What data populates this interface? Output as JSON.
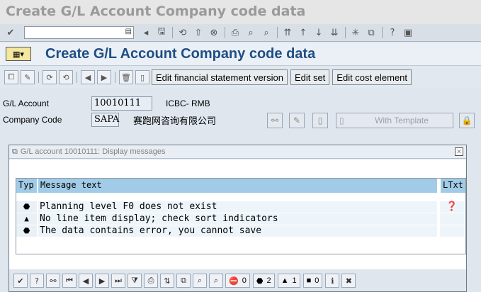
{
  "window": {
    "title": "Create G/L Account Company code data"
  },
  "std_toolbar": {
    "command_value": ""
  },
  "page": {
    "title": "Create G/L Account Company code data"
  },
  "app_toolbar": {
    "buttons": [
      "Edit financial statement version",
      "Edit set",
      "Edit cost element"
    ]
  },
  "form": {
    "gl_account_label": "G/L Account",
    "gl_account_value": "10010111",
    "gl_account_desc": "ICBC- RMB",
    "company_code_label": "Company Code",
    "company_code_value": "SAPA",
    "company_code_desc": "赛跑网咨询有限公司",
    "with_template_label": "With Template"
  },
  "dialog": {
    "title": "G/L account 10010111: Display messages",
    "columns": {
      "typ": "Typ",
      "text": "Message text",
      "ltxt": "LTxt"
    },
    "messages": [
      {
        "type": "error",
        "text": "Planning level F0 does not exist",
        "has_long_text": true
      },
      {
        "type": "warning",
        "text": "No line item display; check sort indicators",
        "has_long_text": false
      },
      {
        "type": "error",
        "text": "The data contains error, you cannot save",
        "has_long_text": false
      }
    ],
    "counts": {
      "stop": "0",
      "error": "2",
      "warning": "1",
      "info": "0"
    }
  },
  "colors": {
    "title_blue": "#1f4e85",
    "header_blue": "#a1cbe6"
  }
}
